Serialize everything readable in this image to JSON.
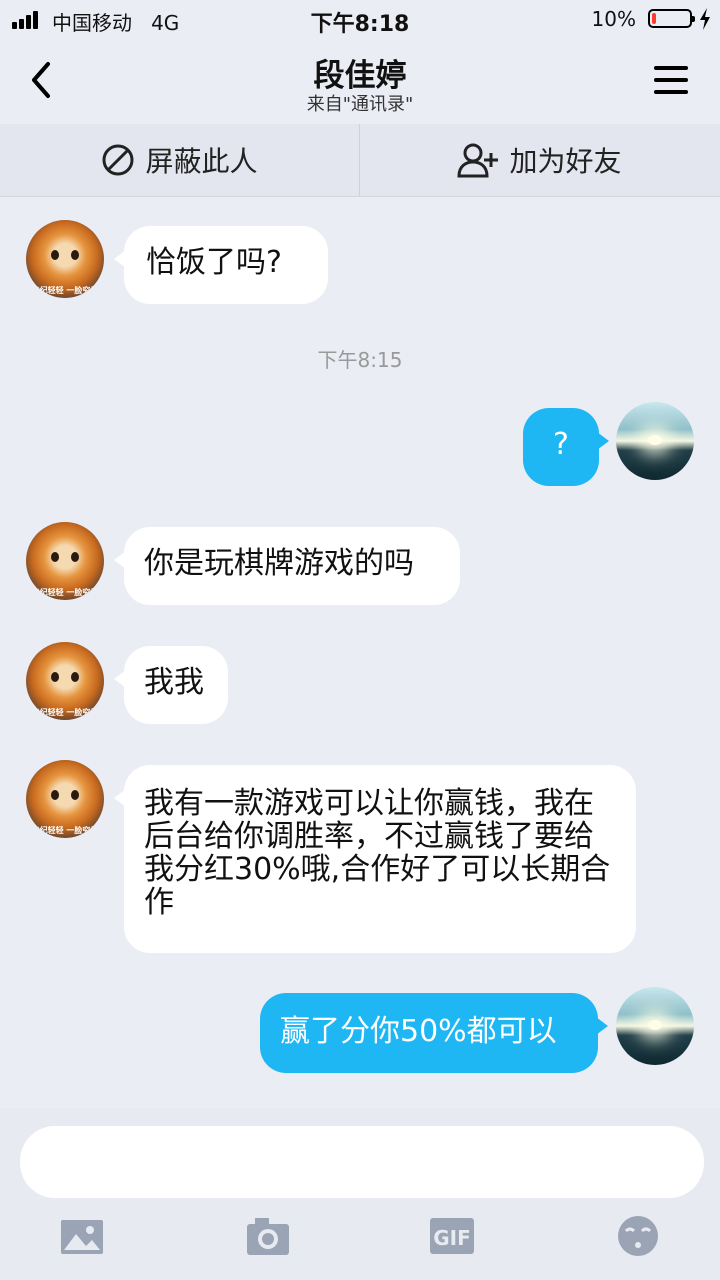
{
  "status_bar": {
    "carrier": "中国移动",
    "network": "4G",
    "time": "下午8:18",
    "battery_percent": "10%",
    "battery_level": 0.1,
    "icons": [
      "signal-icon",
      "battery-icon",
      "charging-icon"
    ]
  },
  "header": {
    "title": "段佳婷",
    "subtitle": "来自\"通讯录\"",
    "icons": [
      "back-icon",
      "menu-icon"
    ]
  },
  "actions": {
    "block_label": "屏蔽此人",
    "add_friend_label": "加为好友",
    "icons": [
      "block-icon",
      "add-friend-icon"
    ]
  },
  "messages": [
    {
      "side": "left",
      "text": "恰饭了吗?"
    },
    {
      "side": "right",
      "text": "?"
    },
    {
      "side": "left",
      "text": "你是玩棋牌游戏的吗"
    },
    {
      "side": "left",
      "text": "我我"
    },
    {
      "side": "left",
      "text": "我有一款游戏可以让你赢钱，我在后台给你调胜率，不过赢钱了要给我分红30%哦,合作好了可以长期合作"
    },
    {
      "side": "right",
      "text": "赢了分你50%都可以"
    }
  ],
  "timestamp": "下午8:15",
  "avatar_caption": "年纪轻轻 一脸穷样",
  "input": {
    "value": "",
    "placeholder": ""
  },
  "toolbar": {
    "gif_label": "GIF",
    "icons": [
      "image-icon",
      "camera-icon",
      "gif-icon",
      "emoji-icon"
    ]
  },
  "colors": {
    "background": "#ebedf5",
    "sent_bubble": "#1eb6f3",
    "received_bubble": "#ffffff",
    "battery_low": "#ff3b30"
  }
}
